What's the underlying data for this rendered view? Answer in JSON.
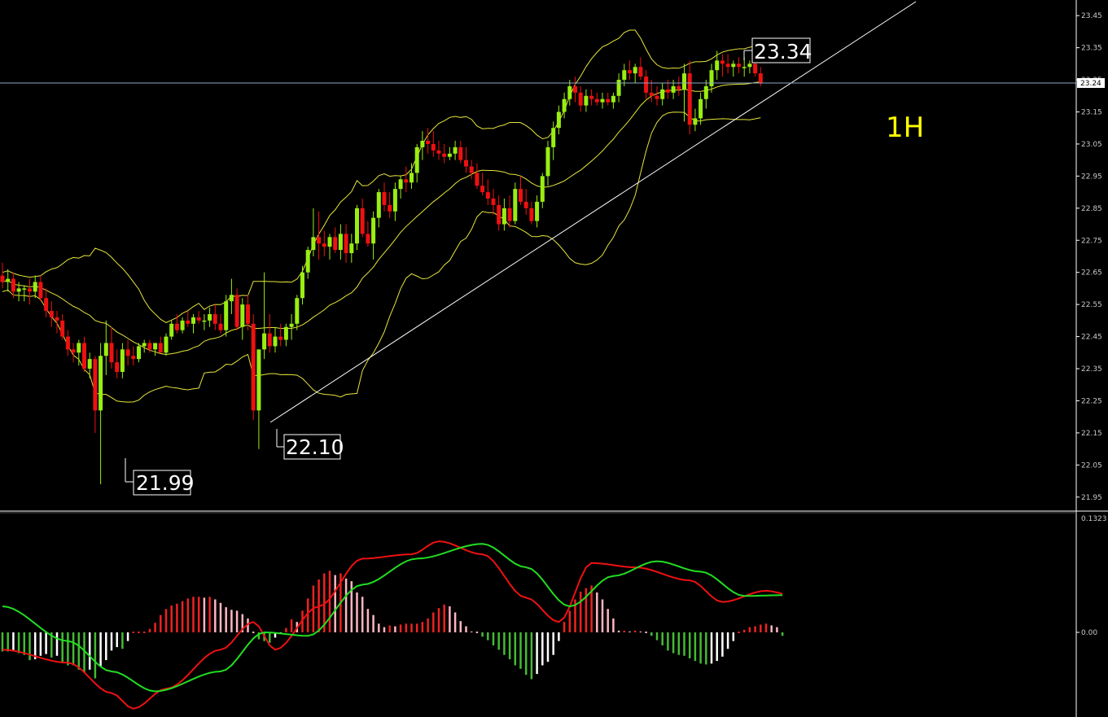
{
  "timeframe": "1H",
  "colors": {
    "background": "#000000",
    "bull": "#99ee11",
    "bear": "#ee1111",
    "bands": "#e6e63c",
    "trendline": "#ffffff",
    "current_price_line": "#8ea9c8",
    "hist_pos_rising": "#ee2222",
    "hist_pos_falling": "#ffb6c1",
    "hist_neg_falling": "#44bb33",
    "hist_neg_rising": "#ffffff",
    "macd_line": "#ee1111",
    "signal_line": "#22dd22",
    "axis_text": "#c8c8c8"
  },
  "price_axis": {
    "ticks": [
      "23.45",
      "23.35",
      "23.25",
      "23.15",
      "23.05",
      "22.95",
      "22.85",
      "22.75",
      "22.65",
      "22.55",
      "22.45",
      "22.35",
      "22.25",
      "22.15",
      "22.05",
      "21.95"
    ],
    "current_price": "23.24"
  },
  "annotations": {
    "low1": "21.99",
    "low2": "22.10",
    "high": "23.34"
  },
  "macd_axis": {
    "top": "0.1323",
    "zero": "0.00"
  },
  "chart_data": {
    "type": "candlestick",
    "timeframe": "1H",
    "ylim": [
      21.91,
      23.48
    ],
    "candles": [
      [
        22.64,
        22.68,
        22.6,
        22.62
      ],
      [
        22.62,
        22.66,
        22.59,
        22.63
      ],
      [
        22.63,
        22.65,
        22.57,
        22.59
      ],
      [
        22.59,
        22.62,
        22.56,
        22.6
      ],
      [
        22.6,
        22.61,
        22.56,
        22.6
      ],
      [
        22.6,
        22.63,
        22.55,
        22.59
      ],
      [
        22.59,
        22.64,
        22.57,
        22.62
      ],
      [
        22.62,
        22.64,
        22.56,
        22.57
      ],
      [
        22.57,
        22.6,
        22.51,
        22.53
      ],
      [
        22.53,
        22.56,
        22.48,
        22.51
      ],
      [
        22.51,
        22.53,
        22.46,
        22.5
      ],
      [
        22.5,
        22.52,
        22.44,
        22.45
      ],
      [
        22.45,
        22.47,
        22.39,
        22.41
      ],
      [
        22.41,
        22.43,
        22.37,
        22.4
      ],
      [
        22.4,
        22.44,
        22.36,
        22.43
      ],
      [
        22.43,
        22.45,
        22.34,
        22.35
      ],
      [
        22.35,
        22.4,
        22.32,
        22.38
      ],
      [
        22.38,
        22.39,
        22.15,
        22.22
      ],
      [
        22.22,
        22.43,
        21.99,
        22.39
      ],
      [
        22.39,
        22.5,
        22.33,
        22.43
      ],
      [
        22.43,
        22.48,
        22.35,
        22.37
      ],
      [
        22.37,
        22.41,
        22.32,
        22.34
      ],
      [
        22.34,
        22.43,
        22.32,
        22.41
      ],
      [
        22.41,
        22.44,
        22.36,
        22.39
      ],
      [
        22.39,
        22.42,
        22.36,
        22.38
      ],
      [
        22.38,
        22.43,
        22.37,
        22.42
      ],
      [
        22.42,
        22.44,
        22.4,
        22.43
      ],
      [
        22.43,
        22.44,
        22.4,
        22.41
      ],
      [
        22.41,
        22.43,
        22.39,
        22.43
      ],
      [
        22.43,
        22.45,
        22.4,
        22.4
      ],
      [
        22.4,
        22.46,
        22.39,
        22.45
      ],
      [
        22.45,
        22.5,
        22.44,
        22.49
      ],
      [
        22.49,
        22.52,
        22.46,
        22.47
      ],
      [
        22.47,
        22.51,
        22.46,
        22.5
      ],
      [
        22.5,
        22.53,
        22.48,
        22.49
      ],
      [
        22.49,
        22.52,
        22.46,
        22.51
      ],
      [
        22.51,
        22.53,
        22.49,
        22.5
      ],
      [
        22.5,
        22.52,
        22.47,
        22.5
      ],
      [
        22.5,
        22.54,
        22.48,
        22.52
      ],
      [
        22.52,
        22.55,
        22.47,
        22.49
      ],
      [
        22.49,
        22.52,
        22.46,
        22.47
      ],
      [
        22.47,
        22.58,
        22.45,
        22.56
      ],
      [
        22.56,
        22.63,
        22.52,
        22.58
      ],
      [
        22.58,
        22.6,
        22.47,
        22.48
      ],
      [
        22.48,
        22.57,
        22.44,
        22.55
      ],
      [
        22.55,
        22.58,
        22.47,
        22.49
      ],
      [
        22.49,
        22.52,
        22.19,
        22.22
      ],
      [
        22.22,
        22.35,
        22.1,
        22.41
      ],
      [
        22.41,
        22.65,
        22.38,
        22.46
      ],
      [
        22.46,
        22.52,
        22.4,
        22.42
      ],
      [
        22.42,
        22.48,
        22.4,
        22.45
      ],
      [
        22.45,
        22.49,
        22.42,
        22.44
      ],
      [
        22.44,
        22.49,
        22.42,
        22.48
      ],
      [
        22.48,
        22.52,
        22.44,
        22.49
      ],
      [
        22.49,
        22.58,
        22.47,
        22.57
      ],
      [
        22.57,
        22.67,
        22.55,
        22.65
      ],
      [
        22.65,
        22.73,
        22.63,
        22.72
      ],
      [
        22.72,
        22.85,
        22.7,
        22.76
      ],
      [
        22.76,
        22.84,
        22.69,
        22.74
      ],
      [
        22.74,
        22.78,
        22.7,
        22.73
      ],
      [
        22.73,
        22.77,
        22.69,
        22.76
      ],
      [
        22.76,
        22.79,
        22.71,
        22.72
      ],
      [
        22.72,
        22.8,
        22.69,
        22.77
      ],
      [
        22.77,
        22.8,
        22.68,
        22.71
      ],
      [
        22.71,
        22.77,
        22.68,
        22.74
      ],
      [
        22.74,
        22.86,
        22.72,
        22.85
      ],
      [
        22.85,
        22.88,
        22.76,
        22.77
      ],
      [
        22.77,
        22.81,
        22.73,
        22.74
      ],
      [
        22.74,
        22.84,
        22.69,
        22.82
      ],
      [
        22.82,
        22.91,
        22.79,
        22.9
      ],
      [
        22.9,
        22.93,
        22.84,
        22.86
      ],
      [
        22.86,
        22.9,
        22.82,
        22.84
      ],
      [
        22.84,
        22.93,
        22.81,
        22.91
      ],
      [
        22.91,
        22.95,
        22.88,
        22.94
      ],
      [
        22.94,
        22.98,
        22.9,
        22.93
      ],
      [
        22.93,
        22.99,
        22.91,
        22.96
      ],
      [
        22.96,
        23.05,
        22.93,
        23.04
      ],
      [
        23.04,
        23.09,
        23.0,
        23.06
      ],
      [
        23.06,
        23.1,
        23.02,
        23.05
      ],
      [
        23.05,
        23.09,
        23.01,
        23.03
      ],
      [
        23.03,
        23.06,
        23.0,
        23.02
      ],
      [
        23.02,
        23.05,
        22.99,
        23.01
      ],
      [
        23.01,
        23.04,
        23.0,
        23.02
      ],
      [
        23.02,
        23.06,
        23.0,
        23.04
      ],
      [
        23.04,
        23.06,
        22.99,
        23.0
      ],
      [
        23.0,
        23.04,
        22.96,
        22.98
      ],
      [
        22.98,
        23.0,
        22.94,
        22.96
      ],
      [
        22.96,
        22.99,
        22.91,
        22.92
      ],
      [
        22.92,
        22.96,
        22.89,
        22.9
      ],
      [
        22.9,
        22.94,
        22.86,
        22.88
      ],
      [
        22.88,
        22.91,
        22.83,
        22.86
      ],
      [
        22.86,
        22.89,
        22.78,
        22.8
      ],
      [
        22.8,
        22.88,
        22.78,
        22.85
      ],
      [
        22.85,
        22.89,
        22.79,
        22.81
      ],
      [
        22.81,
        22.93,
        22.8,
        22.91
      ],
      [
        22.91,
        22.95,
        22.86,
        22.87
      ],
      [
        22.87,
        22.91,
        22.83,
        22.85
      ],
      [
        22.85,
        22.87,
        22.8,
        22.81
      ],
      [
        22.81,
        22.89,
        22.79,
        22.87
      ],
      [
        22.87,
        22.96,
        22.85,
        22.95
      ],
      [
        22.95,
        23.06,
        22.92,
        23.04
      ],
      [
        23.04,
        23.12,
        23.0,
        23.1
      ],
      [
        23.1,
        23.17,
        23.08,
        23.15
      ],
      [
        23.15,
        23.21,
        23.13,
        23.19
      ],
      [
        23.19,
        23.25,
        23.17,
        23.23
      ],
      [
        23.23,
        23.26,
        23.18,
        23.21
      ],
      [
        23.21,
        23.23,
        23.15,
        23.17
      ],
      [
        23.17,
        23.22,
        23.15,
        23.2
      ],
      [
        23.2,
        23.22,
        23.17,
        23.19
      ],
      [
        23.19,
        23.21,
        23.17,
        23.18
      ],
      [
        23.18,
        23.21,
        23.16,
        23.19
      ],
      [
        23.19,
        23.21,
        23.17,
        23.18
      ],
      [
        23.18,
        23.21,
        23.16,
        23.2
      ],
      [
        23.2,
        23.27,
        23.18,
        23.25
      ],
      [
        23.25,
        23.3,
        23.23,
        23.28
      ],
      [
        23.28,
        23.31,
        23.25,
        23.27
      ],
      [
        23.27,
        23.3,
        23.24,
        23.29
      ],
      [
        23.29,
        23.32,
        23.25,
        23.26
      ],
      [
        23.26,
        23.28,
        23.19,
        23.21
      ],
      [
        23.21,
        23.25,
        23.18,
        23.2
      ],
      [
        23.2,
        23.23,
        23.17,
        23.19
      ],
      [
        23.19,
        23.24,
        23.17,
        23.22
      ],
      [
        23.22,
        23.25,
        23.19,
        23.21
      ],
      [
        23.21,
        23.25,
        23.19,
        23.23
      ],
      [
        23.23,
        23.26,
        23.2,
        23.22
      ],
      [
        23.22,
        23.3,
        23.12,
        23.27
      ],
      [
        23.27,
        23.31,
        23.08,
        23.11
      ],
      [
        23.11,
        23.16,
        23.09,
        23.13
      ],
      [
        23.13,
        23.21,
        23.11,
        23.19
      ],
      [
        23.19,
        23.25,
        23.16,
        23.23
      ],
      [
        23.23,
        23.3,
        23.21,
        23.28
      ],
      [
        23.28,
        23.34,
        23.25,
        23.31
      ],
      [
        23.31,
        23.33,
        23.26,
        23.3
      ],
      [
        23.3,
        23.33,
        23.27,
        23.29
      ],
      [
        23.29,
        23.31,
        23.26,
        23.3
      ],
      [
        23.3,
        23.32,
        23.27,
        23.29
      ],
      [
        23.29,
        23.32,
        23.26,
        23.29
      ],
      [
        23.29,
        23.31,
        23.27,
        23.3
      ],
      [
        23.3,
        23.31,
        23.26,
        23.27
      ],
      [
        23.27,
        23.29,
        23.23,
        23.24
      ]
    ],
    "macd_ylim": [
      -0.0823,
      0.1323
    ],
    "macd_line_points": [
      [
        0,
        -0.02
      ],
      [
        12,
        -0.035
      ],
      [
        20,
        -0.07
      ],
      [
        24,
        -0.088
      ],
      [
        30,
        -0.065
      ],
      [
        40,
        -0.02
      ],
      [
        46,
        0.012
      ],
      [
        50,
        -0.02
      ],
      [
        58,
        0.03
      ],
      [
        66,
        0.085
      ],
      [
        75,
        0.09
      ],
      [
        80,
        0.105
      ],
      [
        88,
        0.09
      ],
      [
        96,
        0.04
      ],
      [
        102,
        0.012
      ],
      [
        108,
        0.08
      ],
      [
        116,
        0.075
      ],
      [
        126,
        0.06
      ],
      [
        132,
        0.035
      ],
      [
        140,
        0.048
      ],
      [
        144,
        0.044
      ]
    ],
    "signal_line_points": [
      [
        0,
        0.03
      ],
      [
        12,
        -0.01
      ],
      [
        20,
        -0.045
      ],
      [
        28,
        -0.068
      ],
      [
        40,
        -0.045
      ],
      [
        48,
        0.0
      ],
      [
        56,
        -0.004
      ],
      [
        66,
        0.055
      ],
      [
        76,
        0.085
      ],
      [
        88,
        0.102
      ],
      [
        96,
        0.075
      ],
      [
        104,
        0.03
      ],
      [
        112,
        0.065
      ],
      [
        120,
        0.082
      ],
      [
        128,
        0.07
      ],
      [
        136,
        0.042
      ],
      [
        144,
        0.043
      ]
    ],
    "histogram": [
      -0.022,
      -0.022,
      -0.021,
      -0.024,
      -0.026,
      -0.032,
      -0.031,
      -0.027,
      -0.025,
      -0.029,
      -0.027,
      -0.035,
      -0.038,
      -0.038,
      -0.043,
      -0.046,
      -0.043,
      -0.053,
      -0.039,
      -0.032,
      -0.021,
      -0.017,
      -0.019,
      -0.01,
      0,
      0,
      0,
      0.004,
      0.011,
      0.02,
      0.027,
      0.031,
      0.033,
      0.036,
      0.039,
      0.041,
      0.041,
      0.04,
      0.041,
      0.038,
      0.034,
      0.029,
      0.026,
      0.025,
      0.021,
      0.016,
      0,
      -0.008,
      -0.01,
      -0.012,
      -0.006,
      -0.001,
      0.005,
      0.015,
      0.012,
      0.025,
      0.039,
      0.054,
      0.061,
      0.068,
      0.071,
      0.066,
      0.068,
      0.062,
      0.059,
      0.046,
      0.041,
      0.027,
      0.02,
      0.01,
      0.006,
      0.008,
      0.007,
      0.009,
      0.01,
      0.01,
      0.01,
      0.012,
      0.016,
      0.023,
      0.028,
      0.032,
      0.03,
      0.023,
      0.013,
      0.007,
      0.001,
      0,
      -0.005,
      -0.009,
      -0.015,
      -0.02,
      -0.026,
      -0.031,
      -0.038,
      -0.042,
      -0.049,
      -0.054,
      -0.048,
      -0.038,
      -0.034,
      -0.026,
      -0.01,
      0.012,
      0.025,
      0.038,
      0.047,
      0.051,
      0.054,
      0.046,
      0.038,
      0.027,
      0.016,
      0.002,
      0.002,
      0.001,
      0.002,
      0.001,
      0,
      -0.004,
      -0.009,
      -0.015,
      -0.021,
      -0.024,
      -0.026,
      -0.027,
      -0.03,
      -0.033,
      -0.036,
      -0.037,
      -0.036,
      -0.033,
      -0.028,
      -0.019,
      -0.01,
      0,
      0.003,
      0.006,
      0.007,
      0.009,
      0.01,
      0.008,
      0.006,
      -0.004
    ]
  }
}
